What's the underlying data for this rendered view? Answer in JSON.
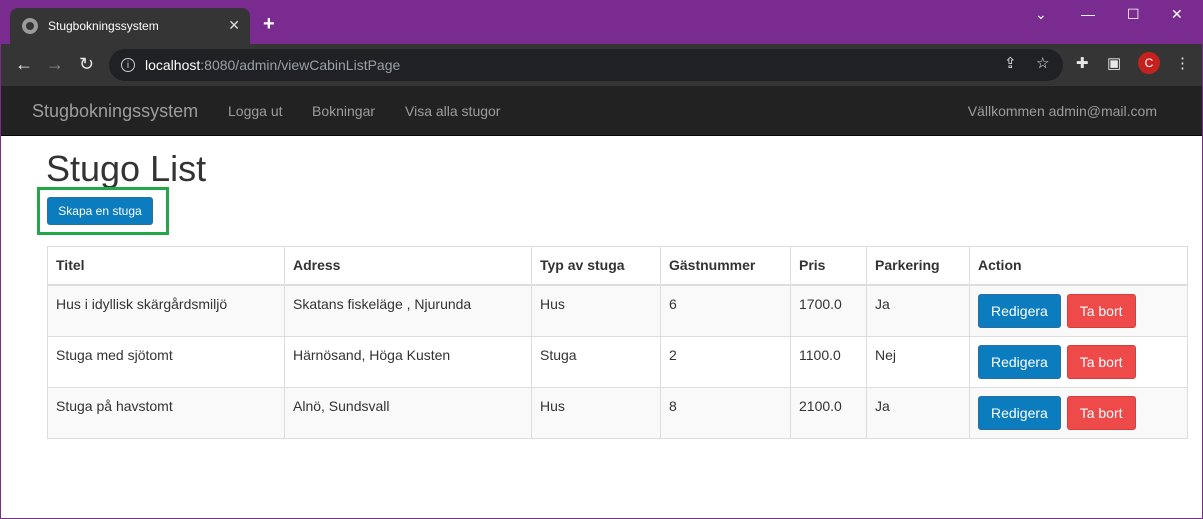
{
  "browser": {
    "tab_title": "Stugbokningssystem",
    "new_tab": "+",
    "url_host": "localhost",
    "url_path": ":8080/admin/viewCabinListPage",
    "profile_initial": "C"
  },
  "navbar": {
    "brand": "Stugbokningssystem",
    "links": [
      "Logga ut",
      "Bokningar",
      "Visa alla stugor"
    ],
    "welcome": "Vällkommen admin@mail.com"
  },
  "page": {
    "title": "Stugo List",
    "create_button": "Skapa en stuga"
  },
  "table": {
    "headers": [
      "Titel",
      "Adress",
      "Typ av stuga",
      "Gästnummer",
      "Pris",
      "Parkering",
      "Action"
    ],
    "rows": [
      [
        "Hus i idyllisk skärgårdsmiljö",
        "Skatans fiskeläge , Njurunda",
        "Hus",
        "6",
        "1700.0",
        "Ja"
      ],
      [
        "Stuga med sjötomt",
        "Härnösand, Höga Kusten",
        "Stuga",
        "2",
        "1100.0",
        "Nej"
      ],
      [
        "Stuga på havstomt",
        "Alnö, Sundsvall",
        "Hus",
        "8",
        "2100.0",
        "Ja"
      ]
    ],
    "edit_label": "Redigera",
    "delete_label": "Ta bort"
  },
  "colors": {
    "primary": "#0b7cbd",
    "danger": "#ee4a4a",
    "highlight": "#22a846",
    "navbar": "#222222"
  }
}
